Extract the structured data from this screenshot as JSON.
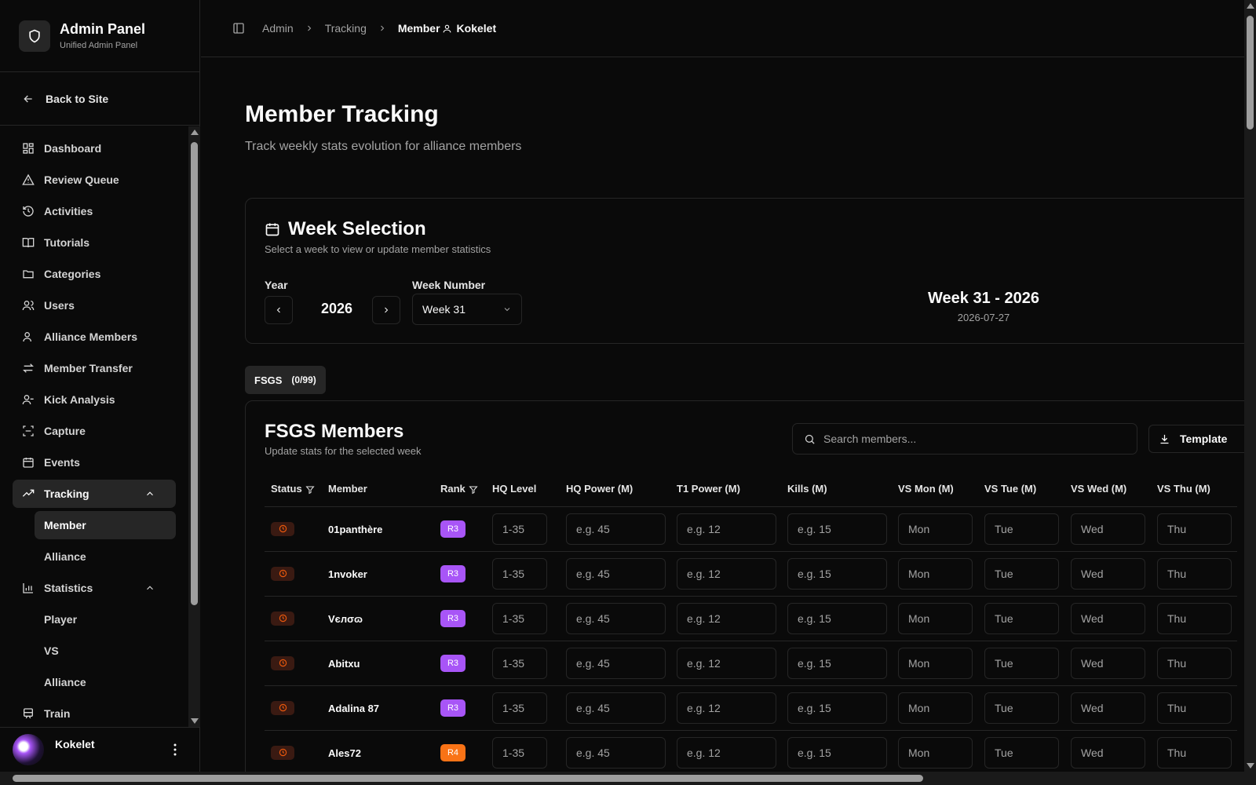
{
  "brand": {
    "title": "Admin Panel",
    "subtitle": "Unified Admin Panel",
    "icon": "shield-icon"
  },
  "back_label": "Back to Site",
  "nav": {
    "dashboard": "Dashboard",
    "review_queue": "Review Queue",
    "activities": "Activities",
    "tutorials": "Tutorials",
    "categories": "Categories",
    "users": "Users",
    "alliance_members": "Alliance Members",
    "member_transfer": "Member Transfer",
    "kick_analysis": "Kick Analysis",
    "capture": "Capture",
    "events": "Events",
    "tracking": "Tracking",
    "tracking_member": "Member",
    "tracking_alliance": "Alliance",
    "statistics": "Statistics",
    "stats_player": "Player",
    "stats_vs": "VS",
    "stats_alliance": "Alliance",
    "train": "Train"
  },
  "user": {
    "name": "Kokelet"
  },
  "breadcrumb": {
    "admin": "Admin",
    "tracking": "Tracking",
    "member": "Member",
    "user": "Kokelet"
  },
  "page": {
    "title": "Member Tracking",
    "subtitle": "Track weekly stats evolution for alliance members"
  },
  "week": {
    "title": "Week Selection",
    "subtitle": "Select a week to view or update member statistics",
    "year_label": "Year",
    "year_value": "2026",
    "week_label": "Week Number",
    "week_value": "Week 31",
    "summary": "Week 31 - 2026",
    "date": "2026-07-27"
  },
  "tab": {
    "label": "FSGS",
    "count": "(0/99)"
  },
  "members_card": {
    "title": "FSGS Members",
    "subtitle": "Update stats for the selected week",
    "search_placeholder": "Search members...",
    "template_label": "Template"
  },
  "table": {
    "headers": [
      "Status",
      "Member",
      "Rank",
      "HQ Level",
      "HQ Power (M)",
      "T1 Power (M)",
      "Kills (M)",
      "VS Mon (M)",
      "VS Tue (M)",
      "VS Wed (M)",
      "VS Thu (M)"
    ],
    "placeholders": {
      "hq_level": "1-35",
      "hq_power": "e.g. 45",
      "t1_power": "e.g. 12",
      "kills": "e.g. 15",
      "mon": "Mon",
      "tue": "Tue",
      "wed": "Wed",
      "thu": "Thu"
    },
    "rows": [
      {
        "member": "01panthère",
        "rank": "R3"
      },
      {
        "member": "1nvoker",
        "rank": "R3"
      },
      {
        "member": "Vєлσɷ",
        "rank": "R3"
      },
      {
        "member": "Abitxu",
        "rank": "R3"
      },
      {
        "member": "Adalina 87",
        "rank": "R3"
      },
      {
        "member": "Ales72",
        "rank": "R4"
      }
    ]
  },
  "colors": {
    "r3": "#a855f7",
    "r4": "#f97316",
    "status": "#ea580c"
  }
}
